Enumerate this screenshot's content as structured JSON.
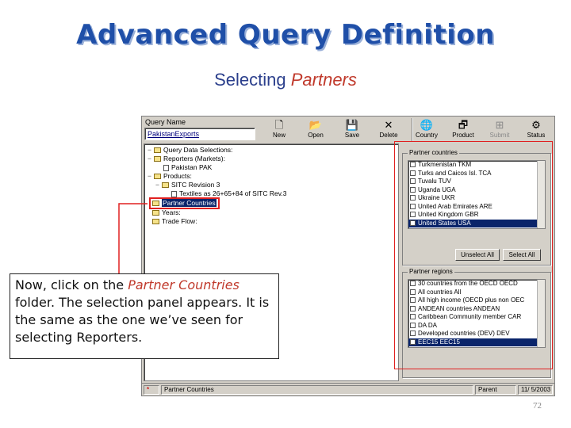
{
  "slide": {
    "title": "Advanced Query Definition",
    "subtitle_prefix": "Selecting ",
    "subtitle_emphasis": "Partners",
    "page_number": "72"
  },
  "query_name": {
    "label": "Query Name",
    "value": "PakistanExports"
  },
  "toolbar": [
    {
      "label": "New",
      "icon": "new-document-icon",
      "glyph": "🗋",
      "enabled": true
    },
    {
      "label": "Open",
      "icon": "open-folder-icon",
      "glyph": "📂",
      "enabled": true
    },
    {
      "label": "Save",
      "icon": "save-disk-icon",
      "glyph": "💾",
      "enabled": true
    },
    {
      "label": "Delete",
      "icon": "delete-x-icon",
      "glyph": "✕",
      "enabled": true
    },
    {
      "label": "Country",
      "icon": "globe-icon",
      "glyph": "🌐",
      "enabled": true
    },
    {
      "label": "Product",
      "icon": "product-icon",
      "glyph": "🗗",
      "enabled": true
    },
    {
      "label": "Submit",
      "icon": "submit-icon",
      "glyph": "⊞",
      "enabled": false
    },
    {
      "label": "Status",
      "icon": "status-icon",
      "glyph": "⚙",
      "enabled": true
    }
  ],
  "tree": {
    "root": "Query Data Selections:",
    "reporters": "Reporters (Markets):",
    "reporter_item": "Pakistan  PAK",
    "products": "Products:",
    "sitc": "SITC Revision 3",
    "textiles": "Textiles as 26+65+84 of SITC Rev.3",
    "partner_countries": "Partner Countries",
    "years": "Years:",
    "trade_flow": "Trade Flow:"
  },
  "partner_countries_panel": {
    "legend": "Partner countries",
    "items": [
      {
        "label": "Turkmenistan  TKM",
        "selected": false
      },
      {
        "label": "Turks and Caicos Isl.  TCA",
        "selected": false
      },
      {
        "label": "Tuvalu  TUV",
        "selected": false
      },
      {
        "label": "Uganda  UGA",
        "selected": false
      },
      {
        "label": "Ukraine  UKR",
        "selected": false
      },
      {
        "label": "United Arab Emirates  ARE",
        "selected": false
      },
      {
        "label": "United Kingdom  GBR",
        "selected": false
      },
      {
        "label": "United States  USA",
        "selected": true
      }
    ],
    "unselect_all": "Unselect All",
    "select_all": "Select All"
  },
  "partner_regions_panel": {
    "legend": "Partner regions",
    "items": [
      {
        "label": "30 countries from the OECD  OECD",
        "selected": false
      },
      {
        "label": "All countries  All",
        "selected": false
      },
      {
        "label": "All high income (OECD plus non OEC",
        "selected": false
      },
      {
        "label": "ANDEAN countries  ANDEAN",
        "selected": false
      },
      {
        "label": "Caribbean Community member  CAR",
        "selected": false
      },
      {
        "label": "DA  DA",
        "selected": false
      },
      {
        "label": "Developed countries (DEV)  DEV",
        "selected": false
      },
      {
        "label": "EEC15  EEC15",
        "selected": true
      }
    ]
  },
  "status_bar": {
    "marker": "*",
    "item": "Partner Countries",
    "mode": "Parent",
    "date": "11/ 5/2003"
  },
  "callout": {
    "before": "Now, click on the ",
    "emphasis": "Partner Countries",
    "after": " folder. The selection panel appears. It is the same as the one we’ve seen for selecting Reporters."
  },
  "colors": {
    "title": "#1f4fa8",
    "emphasis": "#c0392b",
    "highlight_frame": "#e02020",
    "selection": "#0a246a"
  }
}
